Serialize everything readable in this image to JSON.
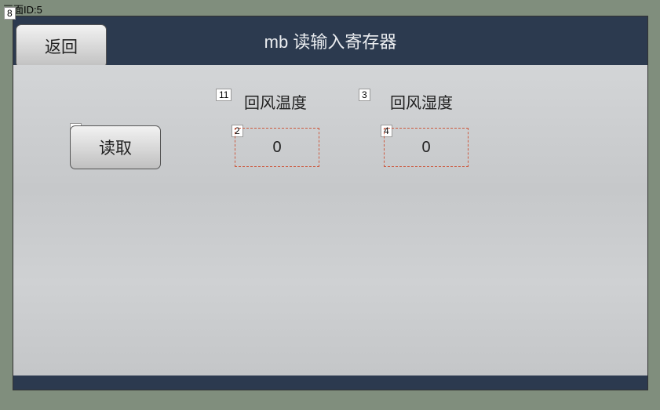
{
  "top_info": "画面ID:5",
  "header": {
    "title": "mb  读输入寄存器",
    "back_label": "返回"
  },
  "labels": {
    "temp": "回风温度",
    "humidity": "回风湿度"
  },
  "read_btn_label": "读取",
  "values": {
    "temp": "0",
    "humidity": "0"
  },
  "tags": {
    "back": "8",
    "read": "1",
    "temp_label": "11",
    "temp_box": "2",
    "humidity_label": "3",
    "humidity_box": "4"
  }
}
